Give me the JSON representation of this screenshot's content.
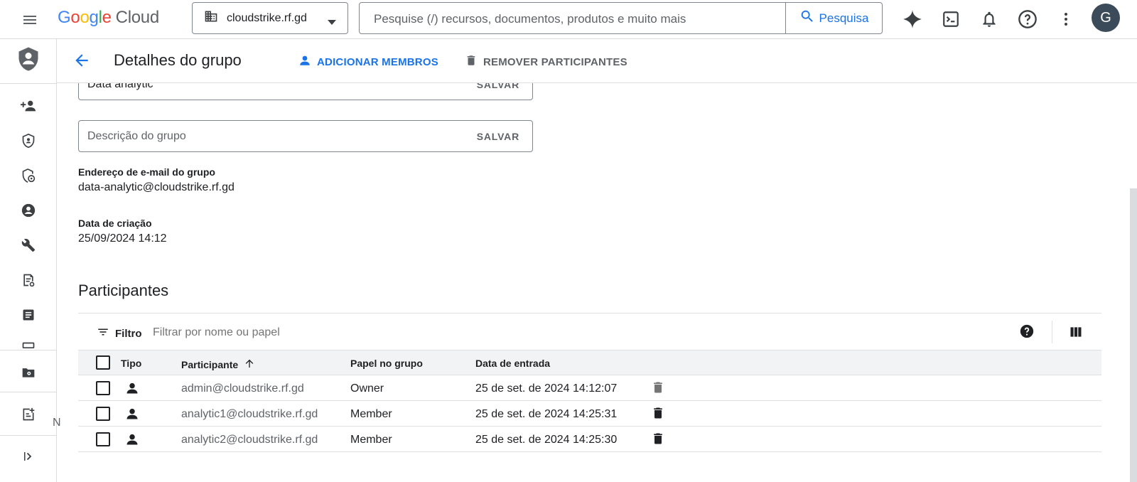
{
  "topbar": {
    "brand": {
      "g1": "G",
      "g2": "o",
      "g3": "o",
      "g4": "g",
      "g5": "l",
      "g6": "e",
      "cloud": "Cloud"
    },
    "project": "cloudstrike.rf.gd",
    "search_placeholder": "Pesquise (/) recursos, documentos, produtos e muito mais",
    "search_button": "Pesquisa",
    "avatar_initial": "G"
  },
  "page": {
    "title": "Detalhes do grupo",
    "add_members": "ADICIONAR MEMBROS",
    "remove_participants": "REMOVER PARTICIPANTES"
  },
  "form": {
    "group_name": "Data analytic",
    "description_placeholder": "Descrição do grupo",
    "save": "SALVAR",
    "email_label": "Endereço de e-mail do grupo",
    "email_value": "data-analytic@cloudstrike.rf.gd",
    "created_label": "Data de criação",
    "created_value": "25/09/2024 14:12"
  },
  "participants": {
    "heading": "Participantes",
    "filter_label": "Filtro",
    "filter_placeholder": "Filtrar por nome ou papel",
    "columns": {
      "type": "Tipo",
      "participant": "Participante",
      "role": "Papel no grupo",
      "joined": "Data de entrada"
    },
    "rows": [
      {
        "email": "admin@cloudstrike.rf.gd",
        "role": "Owner",
        "joined": "25 de set. de 2024 14:12:07"
      },
      {
        "email": "analytic1@cloudstrike.rf.gd",
        "role": "Member",
        "joined": "25 de set. de 2024 14:25:31"
      },
      {
        "email": "analytic2@cloudstrike.rf.gd",
        "role": "Member",
        "joined": "25 de set. de 2024 14:25:30"
      }
    ]
  },
  "rail": {
    "truncated_label": "N"
  },
  "colors": {
    "accent": "#1a73e8",
    "header_row": "#f1f3f4",
    "avatar": "#3c4b59"
  }
}
